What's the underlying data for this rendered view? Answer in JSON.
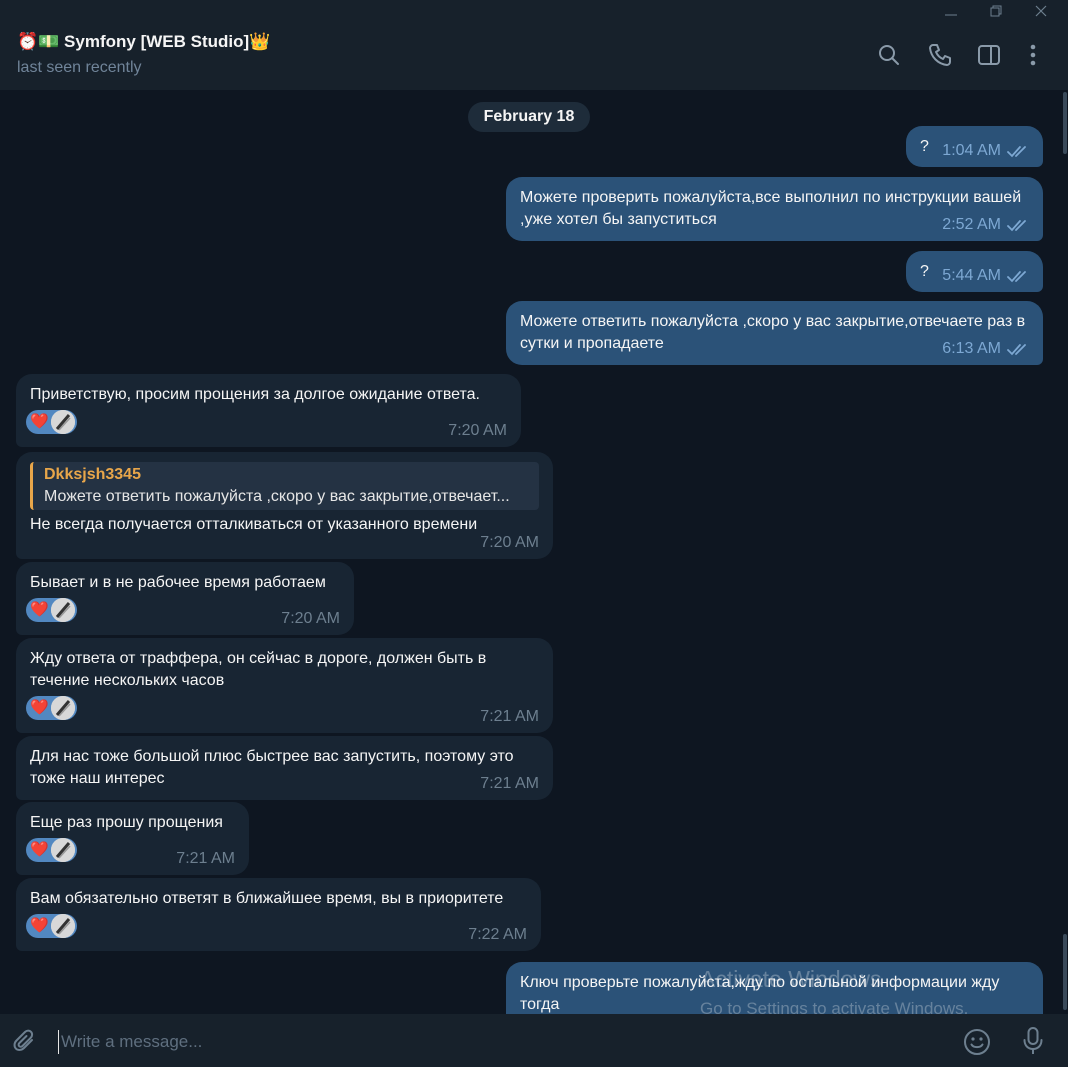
{
  "window": {
    "minimize_icon": "minimize-icon",
    "restore_icon": "restore-icon",
    "close_icon": "close-icon"
  },
  "header": {
    "title": "⏰💵 Symfony [WEB Studio]👑",
    "status": "last seen recently",
    "icons": [
      "search-icon",
      "phone-icon",
      "sidebar-toggle-icon",
      "more-vertical-icon"
    ]
  },
  "chat": {
    "date_label": "February 18",
    "messages": [
      {
        "dir": "out",
        "text": "?",
        "time": "1:04 AM",
        "read": true
      },
      {
        "dir": "out",
        "text": "Можете проверить пожалуйста,все выполнил по инструкции вашей ,уже хотел бы запуститься",
        "time": "2:52 AM",
        "read": true
      },
      {
        "dir": "out",
        "text": "?",
        "time": "5:44 AM",
        "read": true
      },
      {
        "dir": "out",
        "text": "Можете ответить пожалуйста ,скоро у вас закрытие,отвечаете раз в сутки и пропадаете",
        "time": "6:13 AM",
        "read": true
      },
      {
        "dir": "in",
        "text": "Приветствую, просим прощения за долгое ожидание ответа.",
        "time": "7:20 AM",
        "reaction": "❤️"
      },
      {
        "dir": "in",
        "reply": {
          "name": "Dkksjsh3345",
          "text": "Можете ответить пожалуйста ,скоро у вас закрытие,отвечает..."
        },
        "text": "Не всегда получается отталкиваться от указанного времени",
        "time": "7:20 AM"
      },
      {
        "dir": "in",
        "text": "Бывает и в не рабочее время работаем",
        "time": "7:20 AM",
        "reaction": "❤️"
      },
      {
        "dir": "in",
        "text": "Жду ответа от траффера, он сейчас в дороге, должен быть в течение нескольких часов",
        "time": "7:21 AM",
        "reaction": "❤️"
      },
      {
        "dir": "in",
        "text": "Для нас тоже большой плюс быстрее вас запустить, поэтому это тоже наш интерес",
        "time": "7:21 AM"
      },
      {
        "dir": "in",
        "text": "Еще раз прошу прощения",
        "time": "7:21 AM",
        "reaction": "❤️"
      },
      {
        "dir": "in",
        "text": "Вам обязательно ответят в ближайшее время, вы в приоритете",
        "time": "7:22 AM",
        "reaction": "❤️"
      },
      {
        "dir": "out",
        "text": "Ключ проверьте пожалуйста,жду по остальной информации жду тогда",
        "time": "",
        "read": false
      }
    ]
  },
  "composer": {
    "placeholder": "Write a message...",
    "icons": [
      "attach-icon",
      "emoji-icon",
      "microphone-icon"
    ]
  },
  "watermark": {
    "line1": "Activate Windows",
    "line2": "Go to Settings to activate Windows."
  },
  "colors": {
    "background": "#0e1621",
    "header": "#17212b",
    "outgoing_bubble": "#2b5278",
    "incoming_bubble": "#182533",
    "accent": "#5288c1",
    "reply_name": "#e8a64a"
  }
}
